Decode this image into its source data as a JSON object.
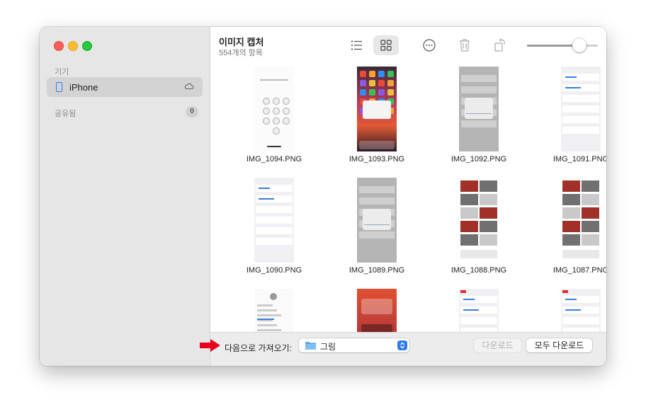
{
  "sidebar": {
    "devices_label": "기기",
    "device_name": "iPhone",
    "shared_label": "공유됨",
    "shared_count": "0"
  },
  "toolbar": {
    "title": "이미지 캡처",
    "subtitle": "554개의 항목",
    "list_icon": "list-view-icon",
    "grid_icon": "grid-view-icon",
    "more_icon": "ellipsis-circle-icon",
    "trash_icon": "trash-icon",
    "rotate_icon": "rotate-icon",
    "zoom_level": 0.75
  },
  "grid": {
    "items": [
      {
        "filename": "IMG_1094.PNG",
        "style": "passcode"
      },
      {
        "filename": "IMG_1093.PNG",
        "style": "homescreen"
      },
      {
        "filename": "IMG_1092.PNG",
        "style": "alert-gray"
      },
      {
        "filename": "IMG_1091.PNG",
        "style": "settings"
      },
      {
        "filename": "IMG_1090.PNG",
        "style": "settings"
      },
      {
        "filename": "IMG_1089.PNG",
        "style": "alert-gray"
      },
      {
        "filename": "IMG_1088.PNG",
        "style": "gallery"
      },
      {
        "filename": "IMG_1087.PNG",
        "style": "gallery"
      },
      {
        "filename": "",
        "style": "contact"
      },
      {
        "filename": "",
        "style": "orange"
      },
      {
        "filename": "",
        "style": "settings-red"
      },
      {
        "filename": "",
        "style": "settings-red"
      }
    ]
  },
  "bottom": {
    "import_label": "다음으로 가져오기:",
    "destination": "그림",
    "download_label": "다운로드",
    "download_all_label": "모두 다운로드"
  },
  "colors": {
    "accent": "#2f7cf6",
    "arrow": "#e8001c"
  }
}
